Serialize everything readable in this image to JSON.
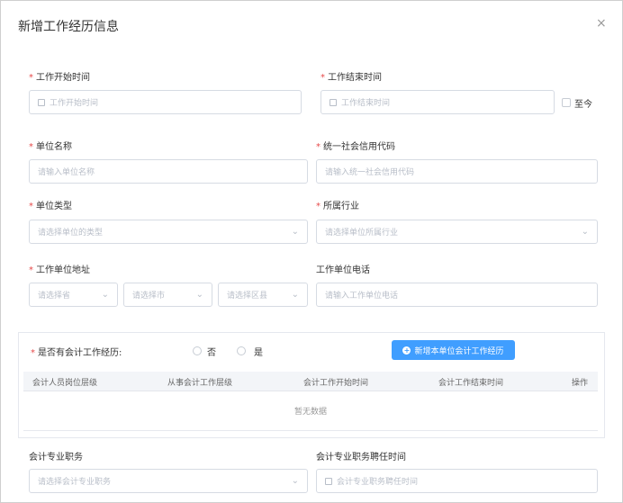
{
  "dialog": {
    "title": "新增工作经历信息",
    "close_glyph": "×"
  },
  "form": {
    "start_date": {
      "label": "工作开始时间",
      "placeholder": "工作开始时间"
    },
    "end_date": {
      "label": "工作结束时间",
      "placeholder": "工作结束时间"
    },
    "until_now": "至今",
    "unit_name": {
      "label": "单位名称",
      "placeholder": "请输入单位名称"
    },
    "credit_code": {
      "label": "统一社会信用代码",
      "placeholder": "请输入统一社会信用代码"
    },
    "unit_type": {
      "label": "单位类型",
      "placeholder": "请选择单位的类型"
    },
    "industry": {
      "label": "所属行业",
      "placeholder": "请选择单位所属行业"
    },
    "address": {
      "label": "工作单位地址",
      "province_placeholder": "请选择省",
      "city_placeholder": "请选择市",
      "district_placeholder": "请选择区县"
    },
    "phone": {
      "label": "工作单位电话",
      "placeholder": "请输入工作单位电话"
    },
    "accounting": {
      "question": "是否有会计工作经历:",
      "option_no": "否",
      "option_yes": "是",
      "add_button": "新增本单位会计工作经历",
      "columns": [
        "会计人员岗位层级",
        "从事会计工作层级",
        "会计工作开始时间",
        "会计工作结束时间",
        "操作"
      ],
      "empty_text": "暂无数据"
    },
    "title_field": {
      "label": "会计专业职务",
      "placeholder": "请选择会计专业职务"
    },
    "title_time": {
      "label": "会计专业职务聘任时间",
      "placeholder": "会计专业职务聘任时间"
    }
  },
  "icons": {
    "close": "close-icon",
    "calendar": "calendar-icon",
    "chevron": "chevron-down-icon",
    "plus": "plus-circle-icon"
  },
  "colors": {
    "primary": "#409eff",
    "required": "#e64a4a",
    "border": "#d6dbe3"
  }
}
